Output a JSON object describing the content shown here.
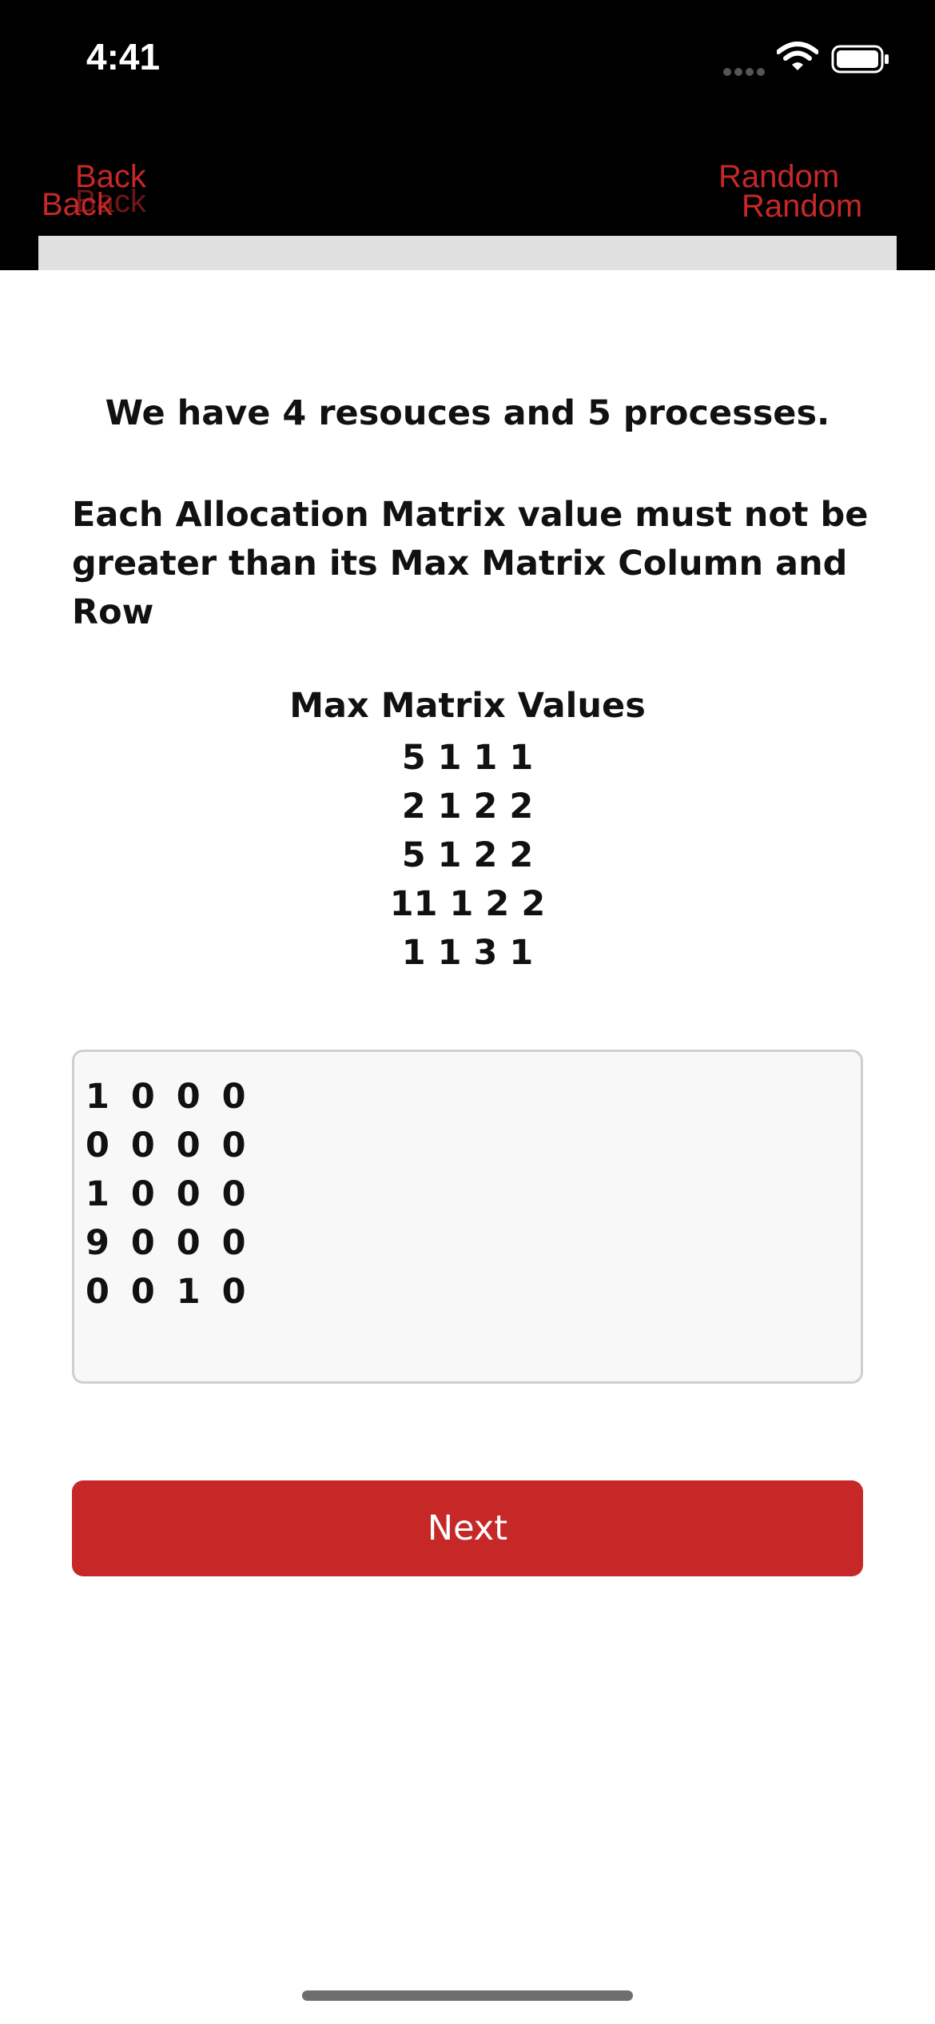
{
  "status_bar": {
    "time": "4:41",
    "icons": [
      "signal-icon",
      "wifi-icon",
      "battery-icon"
    ]
  },
  "nav": {
    "back_label": "Back",
    "random_label": "Random"
  },
  "content": {
    "intro": "We have 4 resouces and 5 processes.",
    "rule": "Each Allocation Matrix value must not be greater than its Max Matrix Column and Row",
    "max_title": "Max Matrix Values",
    "max_rows": [
      "5 1 1 1",
      "2 1 2 2",
      "5 1 2 2",
      "11 1 2 2",
      "1 1 3 1"
    ]
  },
  "allocation_input": {
    "value": "1 0 0 0\n0 0 0 0\n1 0 0 0\n9 0 0 0\n0 0 1 0"
  },
  "next_button": {
    "label": "Next"
  },
  "colors": {
    "accent": "#c62828",
    "nav_background": "#000000",
    "input_background": "#f8f8f8"
  }
}
